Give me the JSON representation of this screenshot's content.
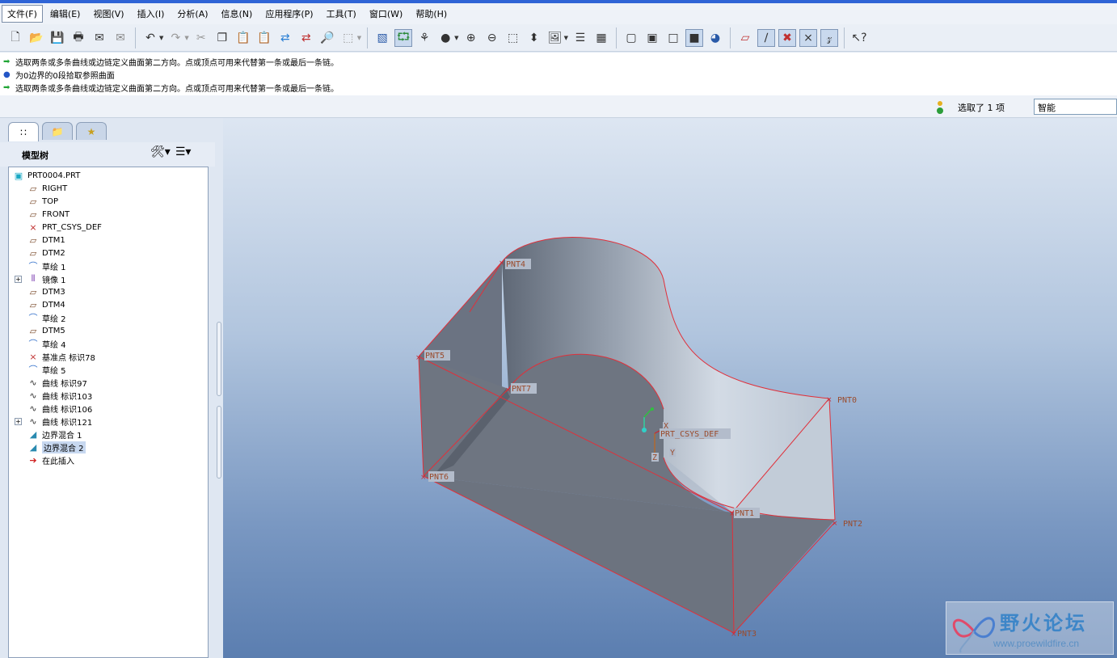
{
  "menu": [
    "文件(F)",
    "编辑(E)",
    "视图(V)",
    "插入(I)",
    "分析(A)",
    "信息(N)",
    "应用程序(P)",
    "工具(T)",
    "窗口(W)",
    "帮助(H)"
  ],
  "messages": [
    {
      "icon": "arrow",
      "text": "选取两条或多条曲线或边链定义曲面第二方向。点或顶点可用来代替第一条或最后一条链。"
    },
    {
      "icon": "dot",
      "text": "为0边界的0段拾取参照曲面"
    },
    {
      "icon": "arrow",
      "text": "选取两条或多条曲线或边链定义曲面第二方向。点或顶点可用来代替第一条或最后一条链。"
    }
  ],
  "status": {
    "selected": "选取了 1 项",
    "filter": "智能"
  },
  "tree": {
    "title": "模型树",
    "items": [
      {
        "label": "PRT0004.PRT",
        "icon": "part-icon",
        "level": 0,
        "expand": false,
        "selected": false
      },
      {
        "label": "RIGHT",
        "icon": "datum-plane-icon",
        "level": 1,
        "expand": false,
        "selected": false
      },
      {
        "label": "TOP",
        "icon": "datum-plane-icon",
        "level": 1,
        "expand": false,
        "selected": false
      },
      {
        "label": "FRONT",
        "icon": "datum-plane-icon",
        "level": 1,
        "expand": false,
        "selected": false
      },
      {
        "label": "PRT_CSYS_DEF",
        "icon": "csys-icon",
        "level": 1,
        "expand": false,
        "selected": false
      },
      {
        "label": "DTM1",
        "icon": "datum-plane-icon",
        "level": 1,
        "expand": false,
        "selected": false
      },
      {
        "label": "DTM2",
        "icon": "datum-plane-icon",
        "level": 1,
        "expand": false,
        "selected": false
      },
      {
        "label": "草绘 1",
        "icon": "sketch-icon",
        "level": 1,
        "expand": false,
        "selected": false
      },
      {
        "label": "镜像 1",
        "icon": "mirror-icon",
        "level": 1,
        "expand": true,
        "selected": false
      },
      {
        "label": "DTM3",
        "icon": "datum-plane-icon",
        "level": 1,
        "expand": false,
        "selected": false
      },
      {
        "label": "DTM4",
        "icon": "datum-plane-icon",
        "level": 1,
        "expand": false,
        "selected": false
      },
      {
        "label": "草绘 2",
        "icon": "sketch-icon",
        "level": 1,
        "expand": false,
        "selected": false
      },
      {
        "label": "DTM5",
        "icon": "datum-plane-icon",
        "level": 1,
        "expand": false,
        "selected": false
      },
      {
        "label": "草绘 4",
        "icon": "sketch-icon",
        "level": 1,
        "expand": false,
        "selected": false
      },
      {
        "label": "基准点 标识78",
        "icon": "datum-point-icon",
        "level": 1,
        "expand": false,
        "selected": false
      },
      {
        "label": "草绘 5",
        "icon": "sketch-icon",
        "level": 1,
        "expand": false,
        "selected": false
      },
      {
        "label": "曲线 标识97",
        "icon": "curve-icon",
        "level": 1,
        "expand": false,
        "selected": false
      },
      {
        "label": "曲线 标识103",
        "icon": "curve-icon",
        "level": 1,
        "expand": false,
        "selected": false
      },
      {
        "label": "曲线 标识106",
        "icon": "curve-icon",
        "level": 1,
        "expand": false,
        "selected": false
      },
      {
        "label": "曲线 标识121",
        "icon": "curve-icon",
        "level": 1,
        "expand": true,
        "selected": false
      },
      {
        "label": "边界混合 1",
        "icon": "boundary-blend-icon",
        "level": 1,
        "expand": false,
        "selected": false
      },
      {
        "label": "边界混合 2",
        "icon": "boundary-blend-icon",
        "level": 1,
        "expand": false,
        "selected": true
      },
      {
        "label": "在此插入",
        "icon": "insert-here-icon",
        "level": 1,
        "expand": false,
        "selected": false
      }
    ]
  },
  "viewport": {
    "points": [
      "PNT0",
      "PNT1",
      "PNT2",
      "PNT3",
      "PNT4",
      "PNT5",
      "PNT6",
      "PNT7"
    ],
    "csys": "PRT_CSYS_DEF",
    "axis_labels": [
      "Y",
      "X",
      "Z"
    ]
  },
  "watermark": {
    "title": "野火论坛",
    "url": "www.proewildfire.cn"
  },
  "colors": {
    "accent": "#2f64d6",
    "edge": "#e0303a",
    "surface": "#b9c4d2",
    "label": "#9a4b2c"
  }
}
